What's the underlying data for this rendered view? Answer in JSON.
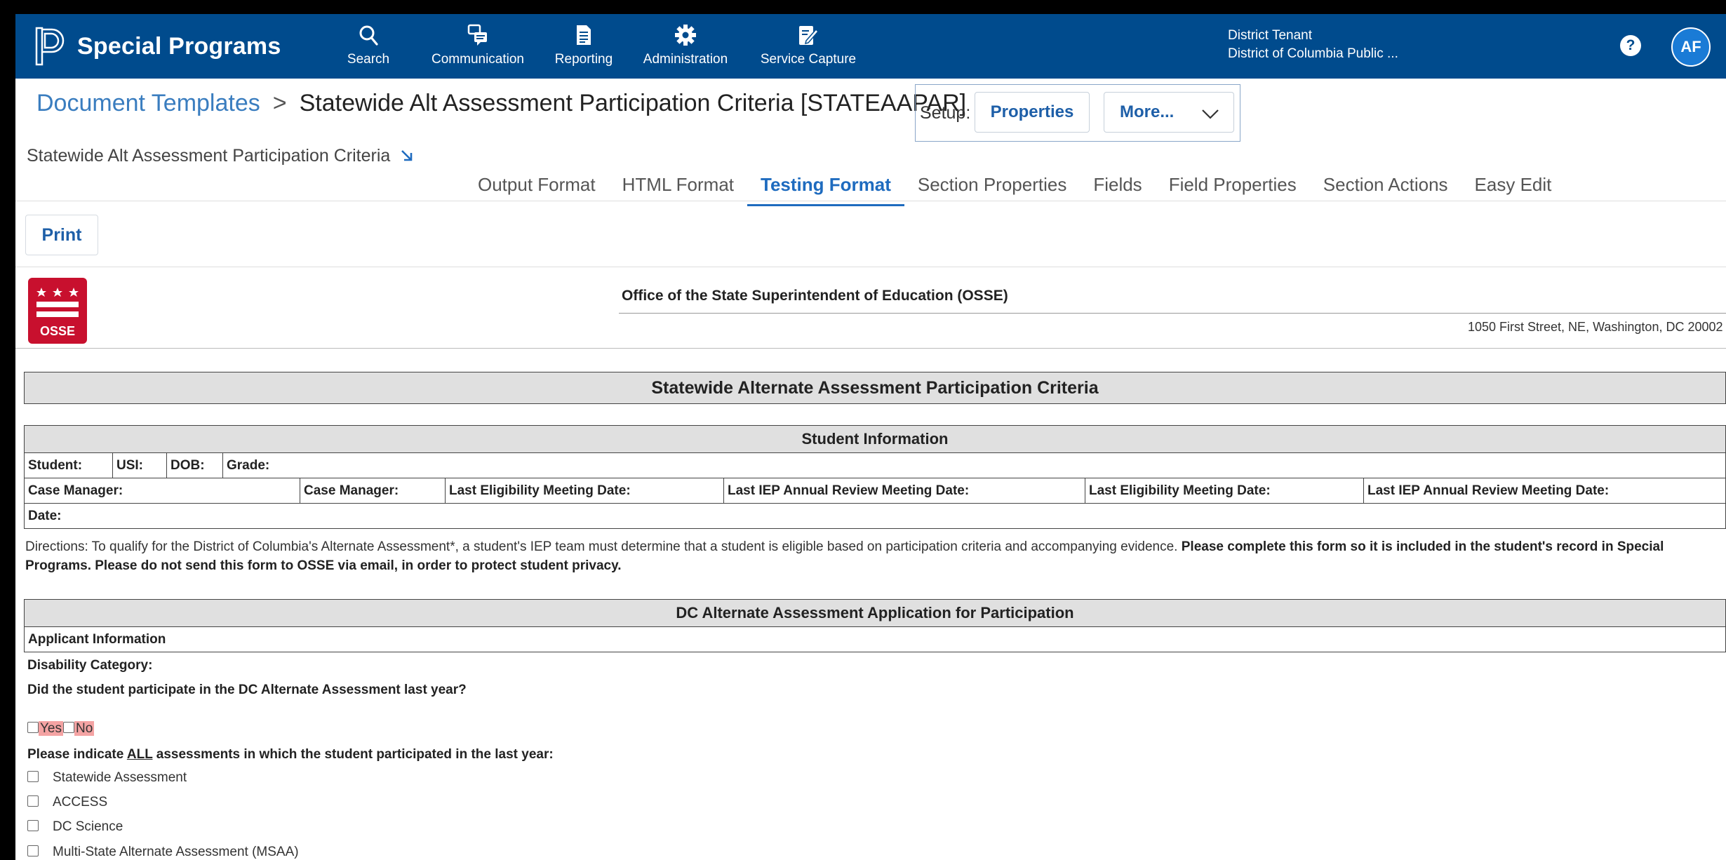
{
  "brand": {
    "title": "Special Programs"
  },
  "nav": {
    "items": [
      {
        "label": "Search",
        "icon": "search-icon"
      },
      {
        "label": "Communication",
        "icon": "communication-icon"
      },
      {
        "label": "Reporting",
        "icon": "reporting-icon"
      },
      {
        "label": "Administration",
        "icon": "gear-icon"
      },
      {
        "label": "Service Capture",
        "icon": "service-capture-icon"
      }
    ],
    "tenant_line1": "District Tenant",
    "tenant_line2": "District of Columbia Public ...",
    "help_label": "?",
    "avatar_initials": "AF"
  },
  "header": {
    "breadcrumb_link": "Document Templates",
    "breadcrumb_sep": ">",
    "breadcrumb_current": "Statewide Alt Assessment Participation Criteria [STATEAAPAR]",
    "subtitle": "Statewide Alt Assessment Participation Criteria",
    "setup_label": "Setup:",
    "properties_label": "Properties",
    "more_label": "More..."
  },
  "tabs": [
    {
      "label": "Output Format",
      "active": false
    },
    {
      "label": "HTML Format",
      "active": false
    },
    {
      "label": "Testing Format",
      "active": true
    },
    {
      "label": "Section Properties",
      "active": false
    },
    {
      "label": "Fields",
      "active": false
    },
    {
      "label": "Field Properties",
      "active": false
    },
    {
      "label": "Section Actions",
      "active": false
    },
    {
      "label": "Easy Edit",
      "active": false
    }
  ],
  "print_label": "Print",
  "document": {
    "logo_text": "OSSE",
    "office": "Office of the State Superintendent of Education (OSSE)",
    "address": "1050 First Street, NE, Washington, DC 20002",
    "main_title": "Statewide Alternate Assessment Participation Criteria",
    "student_section": "Student Information",
    "student_row1": [
      "Student:",
      "USI:",
      "DOB:",
      "Grade:"
    ],
    "student_row2": [
      "Case Manager:",
      "Case Manager:",
      "Last Eligibility Meeting Date:",
      "Last IEP Annual Review Meeting Date:",
      "Last Eligibility Meeting Date:",
      "Last IEP Annual Review Meeting Date:"
    ],
    "student_row3": [
      "Date:"
    ],
    "directions_plain": "Directions: To qualify for the District of Columbia's Alternate Assessment*, a student's IEP team must determine that a student is eligible based on participation criteria and accompanying evidence. ",
    "directions_bold": "Please complete this form so it is included in the student's record in Special Programs. Please do not send this form to OSSE via email, in order to protect student privacy.",
    "app_section": "DC Alternate Assessment Application for Participation",
    "applicant_info": "Applicant Information",
    "disability_category": "Disability Category:",
    "q_last_year": "Did the student participate in the DC Alternate Assessment last year?",
    "yes_label": "Yes",
    "no_label": "No",
    "q_assessments_pre": "Please indicate ",
    "q_assessments_em": "ALL",
    "q_assessments_post": " assessments in which the student participated in the last year:",
    "assessments": [
      "Statewide Assessment",
      "ACCESS",
      "DC Science",
      "Multi-State Alternate Assessment (MSAA)"
    ]
  },
  "colors": {
    "topbar": "#004b8d",
    "accent": "#1e6bbf",
    "osse_red": "#c8102e",
    "highlight": "#f4a3a3"
  }
}
